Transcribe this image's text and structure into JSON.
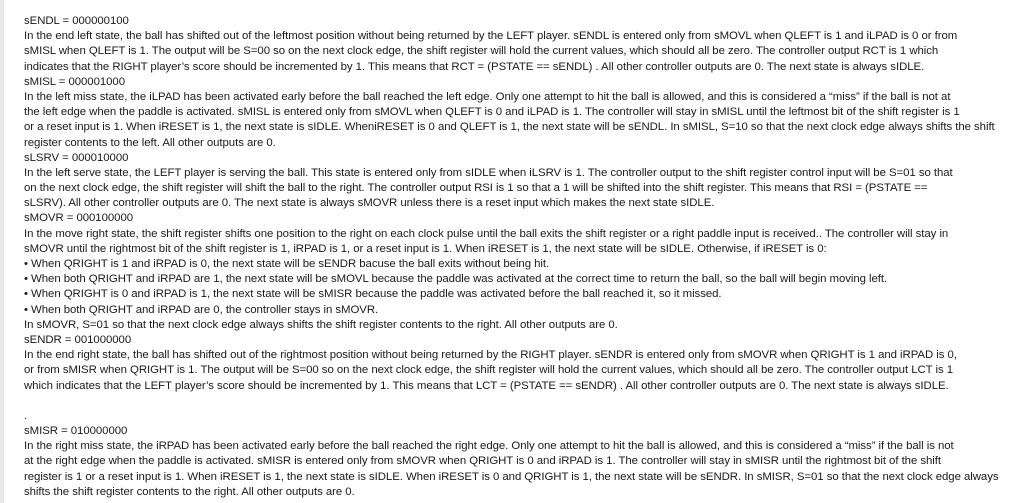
{
  "document": {
    "sections": [
      {
        "heading": "sENDL  = 000000100",
        "lines": [
          "In the end left state, the ball has shifted out of the leftmost position without being returned by the LEFT player. sENDL is entered only from sMOVL when QLEFT is 1  and iLPAD is 0 or from",
          "sMISL when QLEFT is 1. The output will be S=00 so on the next clock edge, the shift register will hold the current values, which should all be zero. The controller output RCT is 1 which",
          "indicates that the RIGHT player’s score should be incremented by 1. This means that RCT = (PSTATE == sENDL) . All other controller outputs are 0. The next state is always sIDLE."
        ]
      },
      {
        "heading": "sMISL  = 000001000",
        "lines": [
          "In the left miss state, the iLPAD has been activated early before the ball reached the left edge. Only one attempt to hit the ball is allowed, and this is considered a “miss” if the ball is not at",
          "the left edge when the paddle is activated.  sMISL is entered only from sMOVL when QLEFT is 0 and iLPAD is 1.  The controller will stay in sMISL until the leftmost bit of the shift register is 1",
          "or a reset input is 1. When iRESET is 1, the next state is sIDLE. WheniRESET is 0 and QLEFT is 1, the next state will be sENDL. In sMISL, S=10 so that the next clock edge always shifts the shift",
          "register contents to the left. All other outputs are 0."
        ]
      },
      {
        "heading": "sLSRV   = 000010000",
        "lines": [
          "In the left serve state, the LEFT player is serving the ball. This state is entered only from sIDLE when iLSRV is 1. The controller output to the shift register control input will be S=01 so that",
          "on the next clock edge, the shift register will shift the ball to the right. The controller output RSI is 1 so that a 1 will be shifted into the shift register. This means that RSI = (PSTATE ==",
          "sLSRV).  All other controller outputs are 0. The next state is always sMOVR unless there is a reset input which makes the next state sIDLE."
        ]
      },
      {
        "heading": "sMOVR = 000100000",
        "lines": [
          "In the move right state, the shift register shifts one position to the right on each clock pulse until the ball exits the shift register or a right paddle input is received.. The controller will stay in",
          "sMOVR until the rightmost bit of the shift register is 1, iRPAD is 1, or a reset input is 1. When iRESET is 1, the next state will be sIDLE. Otherwise, if iRESET is 0:",
          "• When QRIGHT is 1 and iRPAD is 0, the next state will be sENDR bacuse the ball exits without being hit.",
          "• When both QRIGHT and iRPAD are 1, the next state will be sMOVL because the paddle was activated at the correct time to  return the ball, so the ball will begin moving left.",
          "• When QRIGHT is 0 and iRPAD is 1, the next state will be sMISR because the paddle was activated before the ball reached it, so it missed.",
          "• When both QRIGHT and iRPAD are 0, the controller stays in sMOVR.",
          "In sMOVR, S=01 so that the next clock edge always shifts the shift register contents to the right. All other outputs are 0."
        ]
      },
      {
        "heading": "sENDR  = 001000000",
        "lines": [
          "In the end right state, the ball has shifted out of the rightmost position without being returned by the RIGHT player. sENDR is entered only from sMOVR when QRIGHT is 1  and iRPAD is 0,",
          "or from sMISR when QRIGHT is 1. The output will be S=00 so on the next clock edge, the shift register will hold the current values, which should all be zero. The controller output LCT is 1",
          "which indicates that the LEFT player’s score should be incremented by 1. This means that LCT = (PSTATE == sENDR) . All other controller outputs are 0. The next state is always sIDLE.",
          "",
          "."
        ]
      },
      {
        "heading": "sMISR  = 010000000",
        "lines": [
          "In the right miss state, the iRPAD has been activated early before the ball reached the right edge. Only one attempt to hit the ball is allowed, and this is considered a “miss” if the ball is not",
          "at the right edge when the paddle is activated. sMISR is entered only from sMOVR when QRIGHT is 0 and iRPAD is 1.  The controller will stay in sMISR until the rightmost bit of the shift",
          "register is 1 or a reset input is 1. When iRESET is 1, the next state is sIDLE. When iRESET is 0 and QRIGHT is 1, the next state will be sENDR. In sMISR, S=01 so that the next clock edge always",
          "shifts the shift register contents to the right. All other outputs are 0."
        ]
      }
    ]
  }
}
